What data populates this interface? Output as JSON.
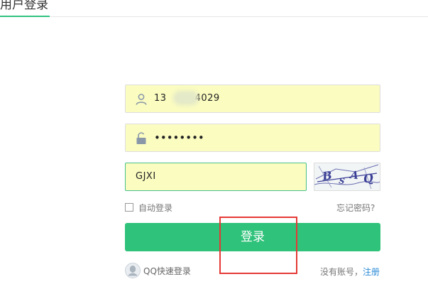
{
  "header": {
    "active_tab": "用户登录"
  },
  "form": {
    "username_value": "13",
    "username_value_tail": "4029",
    "password_value": "••••••••",
    "captcha_value": "GJXI",
    "captcha_image_text": "BSAQ"
  },
  "options": {
    "remember_label": "自动登录",
    "remember_checked": false,
    "forgot_label": "忘记密码?"
  },
  "login_button_label": "登录",
  "footer": {
    "qq_login_label": "QQ快速登录",
    "no_account_label": "没有账号，",
    "register_label": "注册"
  },
  "colors": {
    "accent_green": "#2fc27a",
    "field_background": "#fafcc0",
    "link_blue": "#2b8bd6",
    "annotation_red": "#e53935"
  },
  "icons": [
    "user-icon",
    "lock-icon",
    "qq-avatar-icon"
  ]
}
